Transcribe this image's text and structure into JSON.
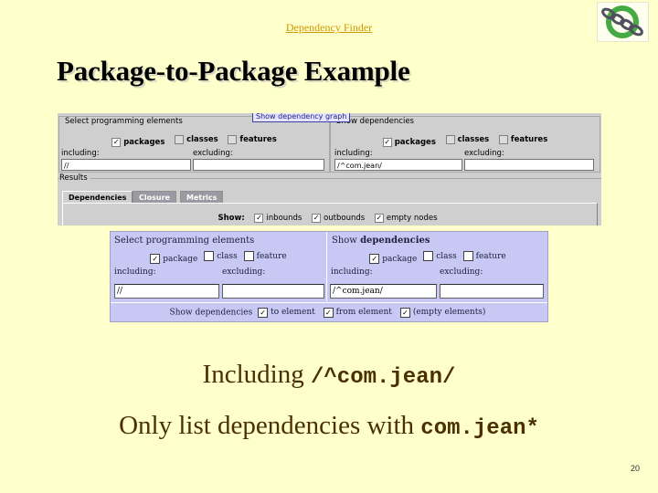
{
  "header": {
    "link_text": "Dependency Finder",
    "logo_icon": "chain-logo-icon"
  },
  "slide": {
    "title": "Package-to-Package Example",
    "line1_text": "Including ",
    "line1_code": "/^com.jean/",
    "line2_text": "Only list dependencies with ",
    "line2_code": "com.jean*",
    "page_number": "20"
  },
  "swing_app": {
    "tooltip": "Show dependency graph",
    "left_panel": {
      "title": "Select programming elements",
      "checkboxes": [
        {
          "label": "packages",
          "checked": true
        },
        {
          "label": "classes",
          "checked": false
        },
        {
          "label": "features",
          "checked": false
        }
      ],
      "including_label": "including:",
      "including_value": "//",
      "excluding_label": "excluding:",
      "excluding_value": ""
    },
    "right_panel": {
      "title": "Show dependencies",
      "checkboxes": [
        {
          "label": "packages",
          "checked": true
        },
        {
          "label": "classes",
          "checked": false
        },
        {
          "label": "features",
          "checked": false
        }
      ],
      "including_label": "including:",
      "including_value": "/^com.jean/",
      "excluding_label": "excluding:",
      "excluding_value": ""
    },
    "results_label": "Results",
    "tabs": [
      {
        "label": "Dependencies",
        "active": true
      },
      {
        "label": "Closure",
        "active": false
      },
      {
        "label": "Metrics",
        "active": false
      }
    ],
    "show_label": "Show:",
    "show_options": [
      {
        "label": "inbounds",
        "checked": true
      },
      {
        "label": "outbounds",
        "checked": true
      },
      {
        "label": "empty nodes",
        "checked": true
      }
    ]
  },
  "web_form": {
    "left": {
      "title": "Select programming elements",
      "checkboxes": [
        {
          "label": "package",
          "checked": true
        },
        {
          "label": "class",
          "checked": false
        },
        {
          "label": "feature",
          "checked": false
        }
      ],
      "including_label": "including:",
      "including_value": "//",
      "excluding_label": "excluding:",
      "excluding_value": ""
    },
    "right": {
      "title_prefix": "Show ",
      "title_bold": "dependencies",
      "checkboxes": [
        {
          "label": "package",
          "checked": true
        },
        {
          "label": "class",
          "checked": false
        },
        {
          "label": "feature",
          "checked": false
        }
      ],
      "including_label": "including:",
      "including_value": "/^com.jean/",
      "excluding_label": "excluding:",
      "excluding_value": ""
    },
    "show_label": "Show dependencies",
    "show_options": [
      {
        "label": "to element",
        "checked": true
      },
      {
        "label": "from element",
        "checked": true
      },
      {
        "label": "(empty elements)",
        "checked": true
      }
    ]
  },
  "check_mark": "✓"
}
